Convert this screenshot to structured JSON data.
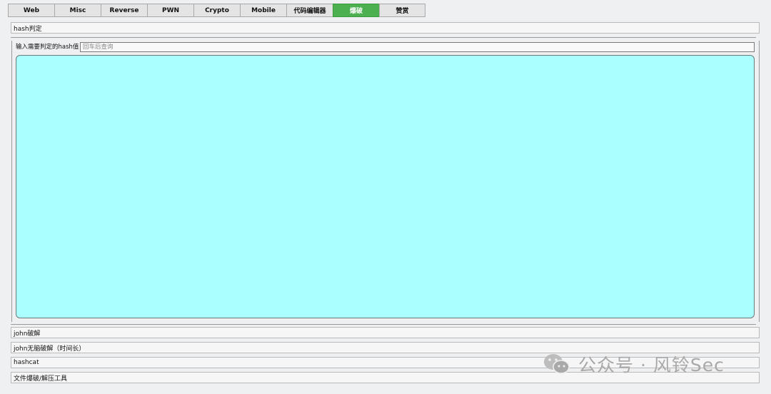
{
  "tabs": [
    {
      "label": "Web",
      "active": false
    },
    {
      "label": "Misc",
      "active": false
    },
    {
      "label": "Reverse",
      "active": false
    },
    {
      "label": "PWN",
      "active": false
    },
    {
      "label": "Crypto",
      "active": false
    },
    {
      "label": "Mobile",
      "active": false
    },
    {
      "label": "代码编辑器",
      "active": false
    },
    {
      "label": "爆破",
      "active": true
    },
    {
      "label": "赞赏",
      "active": false
    }
  ],
  "sections": {
    "hash_judge": {
      "title": "hash判定",
      "input_label": "输入需要判定的hash值",
      "input_placeholder": "回车后查询",
      "input_value": ""
    },
    "john_crack": {
      "title": "john破解"
    },
    "john_brute": {
      "title": "john无脑破解（时间长）"
    },
    "hashcat": {
      "title": "hashcat"
    },
    "file_crack": {
      "title": "文件爆破/解压工具"
    }
  },
  "watermark": {
    "text": "公众号 · 风铃Sec",
    "icon": "wechat-icon"
  },
  "colors": {
    "active_tab": "#4caf50",
    "result_area": "#aaffff"
  }
}
